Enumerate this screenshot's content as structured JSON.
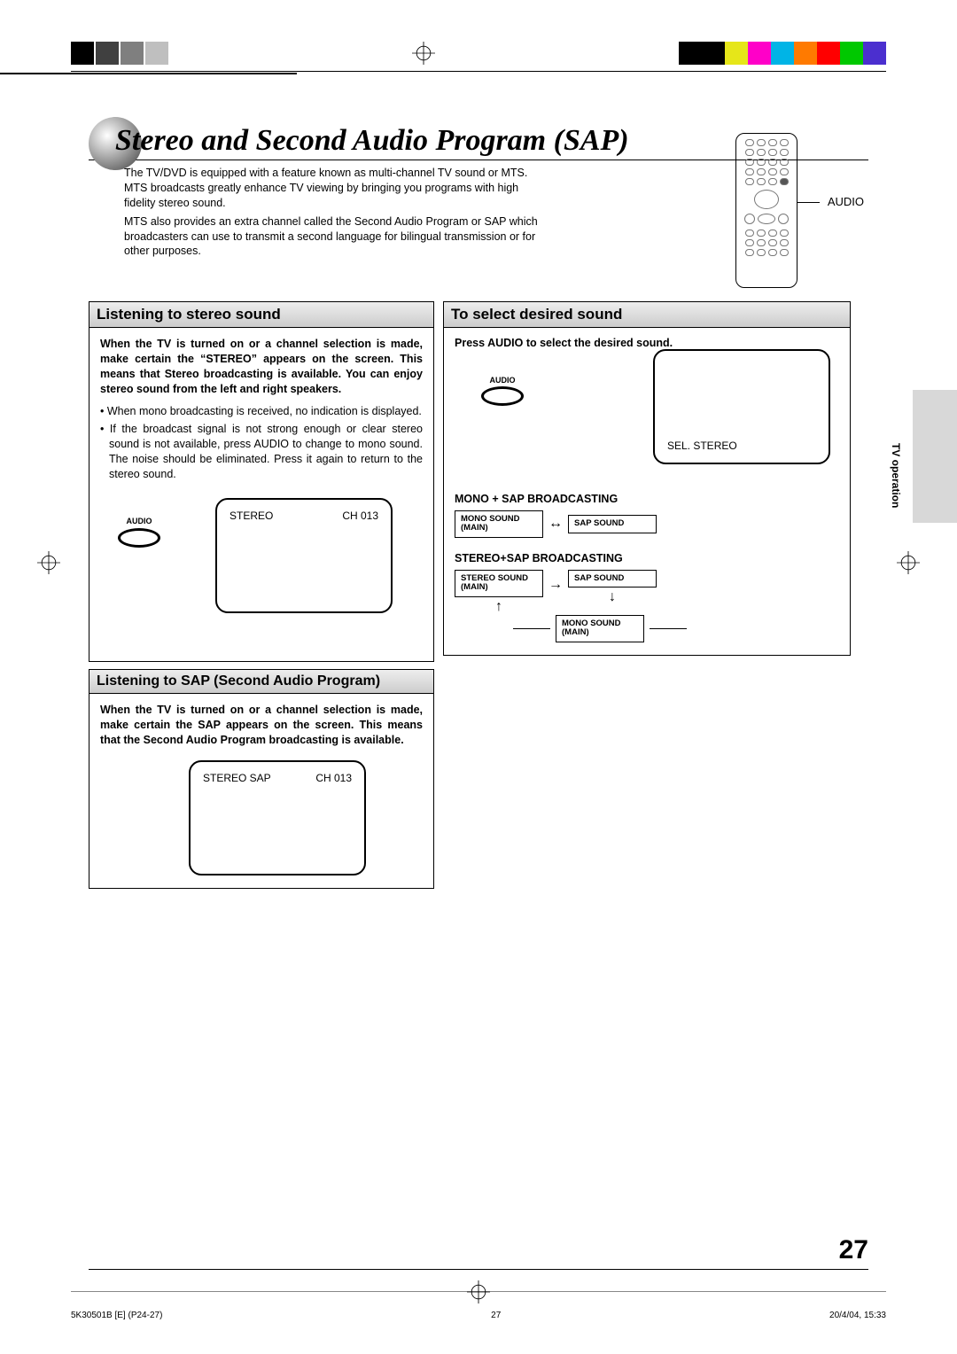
{
  "colorbar": {
    "colors": [
      "#000",
      "#000",
      "#e6e619",
      "#ff00c8",
      "#00b4e6",
      "#ff7a00",
      "#ff0000",
      "#00c800",
      "#4b2fcf"
    ]
  },
  "page": {
    "title": "Stereo and Second Audio Program (SAP)",
    "intro_p1": "The TV/DVD is equipped with a feature known as multi-channel TV sound or MTS. MTS broadcasts greatly enhance TV viewing by bringing you programs with high fidelity stereo sound.",
    "intro_p2": "MTS also provides an extra channel called the Second Audio Program or SAP which broadcasters can use to transmit a second language for bilingual transmission or for other purposes.",
    "remote_label": "AUDIO"
  },
  "sections": {
    "stereo": {
      "title": "Listening to stereo sound",
      "lead": "When the TV is turned on or a channel selection is made, make certain the “STEREO” appears on the screen. This means that Stereo broadcasting is available. You can enjoy stereo sound from the left and right speakers.",
      "b1": "• When mono broadcasting is received, no indication is displayed.",
      "b2": "• If the broadcast signal is not strong enough or clear stereo sound is not available, press AUDIO to change to mono sound. The noise should be eliminated. Press it again to return to the stereo sound.",
      "screen_left": "STEREO",
      "screen_right": "CH 013",
      "audio_label": "AUDIO"
    },
    "sap": {
      "title": "Listening to SAP (Second Audio Program)",
      "lead": "When the TV is turned on or a channel selection is made, make certain the SAP appears on the screen. This means that the Second Audio Program broadcasting is available.",
      "screen_left": "STEREO  SAP",
      "screen_right": "CH 013"
    },
    "select": {
      "title": "To select desired sound",
      "lead": "Press AUDIO to select the desired sound.",
      "audio_label": "AUDIO",
      "screen_text": "SEL. STEREO",
      "mono_sap_head": "MONO + SAP BROADCASTING",
      "mono_sound": "MONO SOUND",
      "main": "(MAIN)",
      "sap_sound": "SAP SOUND",
      "stereo_sap_head": "STEREO+SAP BROADCASTING",
      "stereo_sound": "STEREO SOUND"
    }
  },
  "side_tab": "TV operation",
  "page_number": "27",
  "footer": {
    "left": "5K30501B [E] (P24-27)",
    "mid": "27",
    "right": "20/4/04, 15:33"
  }
}
